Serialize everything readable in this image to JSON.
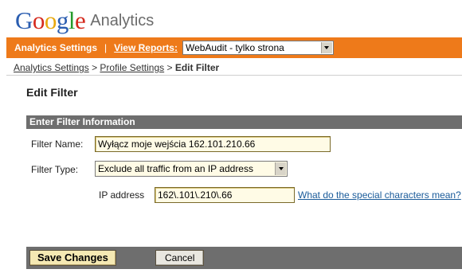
{
  "logo": {
    "letters": [
      "G",
      "o",
      "o",
      "g",
      "l",
      "e"
    ],
    "product": "Analytics"
  },
  "nav": {
    "analytics_settings": "Analytics Settings",
    "separator": "|",
    "view_reports": "View Reports:",
    "report_select_value": "WebAudit - tylko strona"
  },
  "breadcrumb": {
    "item1": "Analytics Settings",
    "sep1": ">",
    "item2": "Profile Settings",
    "sep2": ">",
    "current": "Edit Filter"
  },
  "page_title": "Edit Filter",
  "section": {
    "header": "Enter Filter Information",
    "filter_name_label": "Filter Name:",
    "filter_name_value": "Wyłącz moje wejścia 162.101.210.66",
    "filter_type_label": "Filter Type:",
    "filter_type_value": "Exclude all traffic from an IP address",
    "ip_label": "IP address",
    "ip_value": "162\\.101\\.210\\.66",
    "help_link": "What do the special characters mean?"
  },
  "buttons": {
    "save": "Save Changes",
    "cancel": "Cancel"
  },
  "colors": {
    "nav_bar": "#ee7a1a",
    "section_header": "#6e6e6e",
    "input_background": "#fffbe6",
    "save_button": "#f5e9b3",
    "link": "#1a5b9a"
  }
}
